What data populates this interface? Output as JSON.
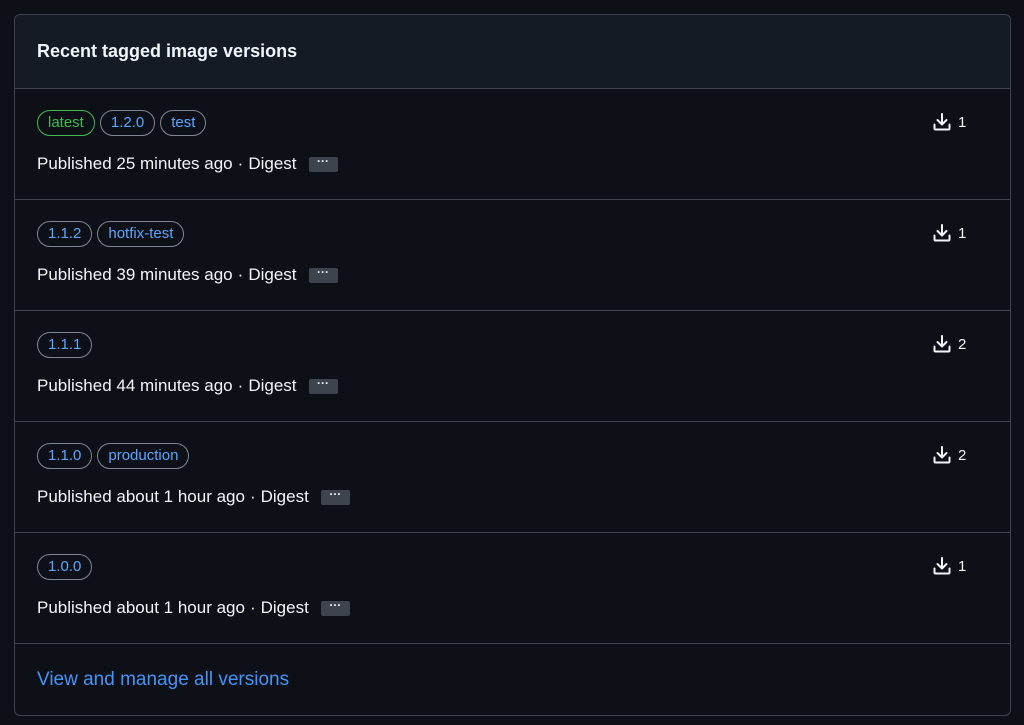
{
  "panel": {
    "title": "Recent tagged image versions"
  },
  "versions": [
    {
      "tags": [
        {
          "label": "latest",
          "color": "green"
        },
        {
          "label": "1.2.0",
          "color": "blue"
        },
        {
          "label": "test",
          "color": "blue"
        }
      ],
      "published": "Published 25 minutes ago",
      "separator": "·",
      "digest_label": "Digest",
      "downloads": "1",
      "download_icon": "download-icon"
    },
    {
      "tags": [
        {
          "label": "1.1.2",
          "color": "blue"
        },
        {
          "label": "hotfix-test",
          "color": "blue"
        }
      ],
      "published": "Published 39 minutes ago",
      "separator": "·",
      "digest_label": "Digest",
      "downloads": "1",
      "download_icon": "download-icon"
    },
    {
      "tags": [
        {
          "label": "1.1.1",
          "color": "blue"
        }
      ],
      "published": "Published 44 minutes ago",
      "separator": "·",
      "digest_label": "Digest",
      "downloads": "2",
      "download_icon": "download-icon"
    },
    {
      "tags": [
        {
          "label": "1.1.0",
          "color": "blue"
        },
        {
          "label": "production",
          "color": "blue"
        }
      ],
      "published": "Published about 1 hour ago",
      "separator": "·",
      "digest_label": "Digest",
      "downloads": "2",
      "download_icon": "download-icon"
    },
    {
      "tags": [
        {
          "label": "1.0.0",
          "color": "blue"
        }
      ],
      "published": "Published about 1 hour ago",
      "separator": "·",
      "digest_label": "Digest",
      "downloads": "1",
      "download_icon": "download-icon"
    }
  ],
  "footer": {
    "link_label": "View and manage all versions"
  },
  "colors": {
    "background": "#0d1117",
    "header_bg": "#151b23",
    "border": "#3d444d",
    "text": "#f0f6fc",
    "link": "#4493f8",
    "tag_green": "#3fb950",
    "tag_blue": "#58a6ff"
  }
}
